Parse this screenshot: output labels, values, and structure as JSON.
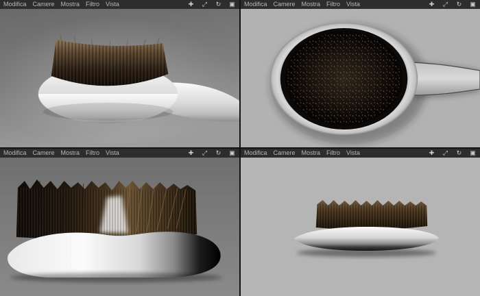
{
  "menu": {
    "items": [
      "Modifica",
      "Camere",
      "Mostra",
      "Filtro",
      "Vista"
    ]
  },
  "viewport_icons": [
    {
      "name": "pan-icon",
      "glyph": "✚"
    },
    {
      "name": "zoom-icon",
      "glyph": "⤢"
    },
    {
      "name": "rotate-icon",
      "glyph": "↻"
    },
    {
      "name": "toggle-view-icon",
      "glyph": "▣"
    }
  ],
  "viewports": [
    {
      "id": "perspective",
      "position": "top-left"
    },
    {
      "id": "top",
      "position": "top-right"
    },
    {
      "id": "front",
      "position": "bottom-left"
    },
    {
      "id": "right",
      "position": "bottom-right"
    }
  ],
  "colors": {
    "menubar_bg": "#2d2d2d",
    "menu_text": "#b8b8b8",
    "divider": "#141414",
    "bg_perspective_top": "#696969",
    "bg_perspective_bottom": "#9c9c9c",
    "bg_top_view": "#b2b2b2",
    "bg_front_view": "#7a7a7a",
    "bg_right_view": "#b5b5b5",
    "handle_light": "#fafafa",
    "handle_dark": "#8f8f8f",
    "bristle_light": "#8d7355",
    "bristle_dark": "#120d09"
  }
}
